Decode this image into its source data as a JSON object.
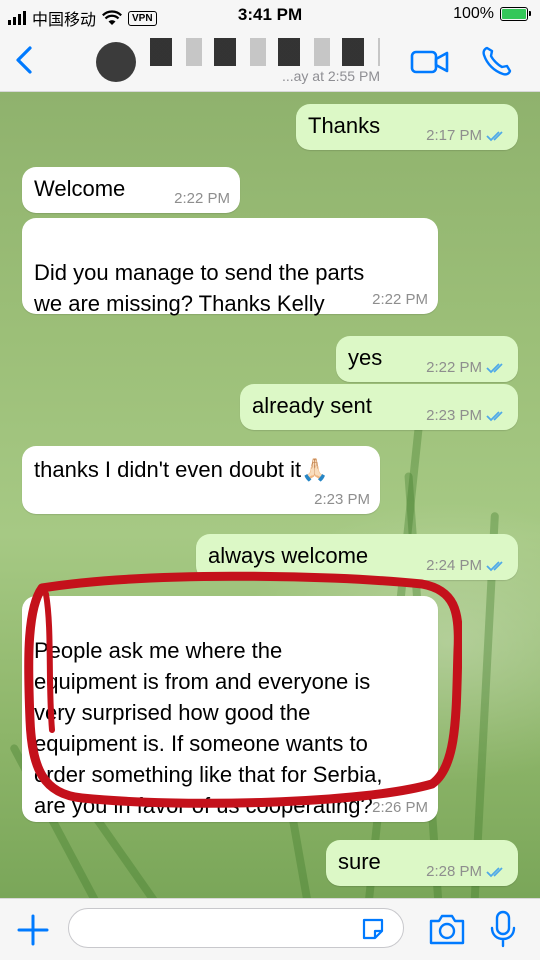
{
  "status_bar": {
    "carrier": "中国移动",
    "vpn_label": "VPN",
    "time": "3:41 PM",
    "battery": "100%"
  },
  "header": {
    "contact_status": "...ay at 2:55 PM"
  },
  "messages": [
    {
      "dir": "out",
      "text": "Thanks",
      "time": "2:17 PM"
    },
    {
      "dir": "in",
      "text": "Welcome",
      "time": "2:22 PM"
    },
    {
      "dir": "in",
      "text": "Did you manage to send the parts\nwe are missing? Thanks Kelly",
      "time": "2:22 PM"
    },
    {
      "dir": "out",
      "text": "yes",
      "time": "2:22 PM"
    },
    {
      "dir": "out",
      "text": "already sent",
      "time": "2:23 PM"
    },
    {
      "dir": "in",
      "text": "thanks I didn't even doubt it🙏🏻",
      "time": "2:23 PM"
    },
    {
      "dir": "out",
      "text": "always welcome",
      "time": "2:24 PM"
    },
    {
      "dir": "in",
      "text": "People ask me where the\nequipment is from and everyone is\nvery surprised how good the\nequipment is. If someone wants to\norder something like that for Serbia,\nare you in favor of us cooperating?",
      "time": "2:26 PM"
    },
    {
      "dir": "out",
      "text": "sure",
      "time": "2:28 PM"
    }
  ],
  "input": {
    "value": "",
    "placeholder": ""
  },
  "colors": {
    "accent": "#007aff",
    "outgoing": "#dcf8c6",
    "incoming": "#ffffff",
    "highlight": "#c4111b",
    "read_ticks": "#4fa9e8"
  },
  "icons": [
    "back-chevron-icon",
    "video-call-icon",
    "phone-call-icon",
    "plus-icon",
    "sticker-icon",
    "camera-icon",
    "microphone-icon",
    "read-receipt-icon"
  ]
}
